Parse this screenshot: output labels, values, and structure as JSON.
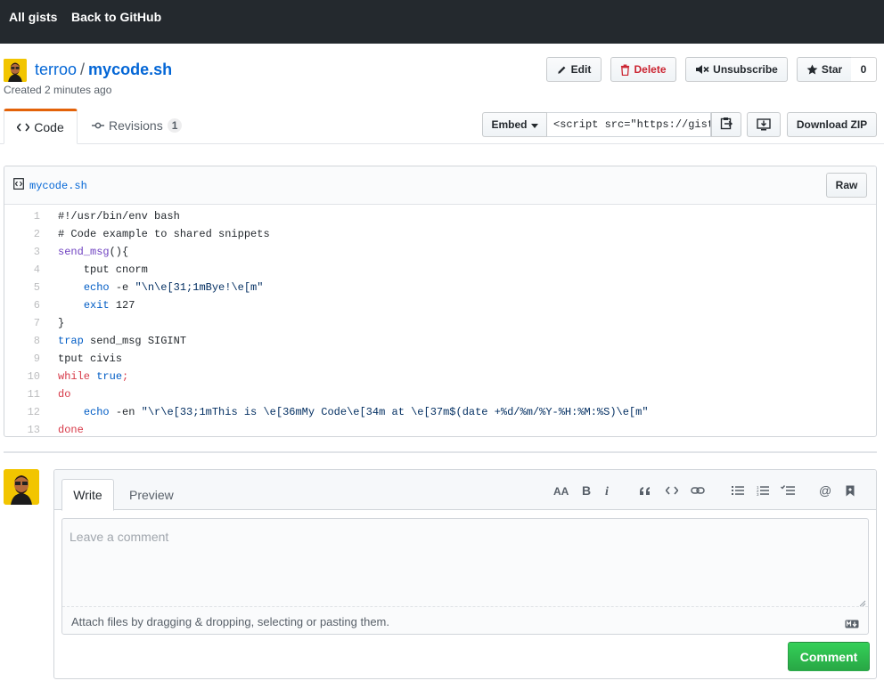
{
  "topbar": {
    "all_gists": "All gists",
    "back_to_github": "Back to GitHub"
  },
  "gist": {
    "owner": "terroo",
    "separator": "/",
    "filename": "mycode.sh",
    "created": "Created 2 minutes ago"
  },
  "actions": {
    "edit": "Edit",
    "delete": "Delete",
    "unsubscribe": "Unsubscribe",
    "star": "Star",
    "star_count": "0"
  },
  "tabs": {
    "code": "Code",
    "revisions": "Revisions",
    "revisions_count": "1"
  },
  "embed": {
    "label": "Embed",
    "value": "<script src=\"https://gist.",
    "download": "Download ZIP"
  },
  "file": {
    "name": "mycode.sh",
    "raw": "Raw",
    "lines": [
      {
        "n": "1",
        "t": "#!/usr/bin/env bash"
      },
      {
        "n": "2",
        "t": "# Code example to shared snippets"
      },
      {
        "n": "3",
        "t": "send_msg(){"
      },
      {
        "n": "4",
        "t": "    tput cnorm"
      },
      {
        "n": "5",
        "t": "    echo -e \"\\n\\e[31;1mBye!\\e[m\""
      },
      {
        "n": "6",
        "t": "    exit 127"
      },
      {
        "n": "7",
        "t": "}"
      },
      {
        "n": "8",
        "t": "trap send_msg SIGINT"
      },
      {
        "n": "9",
        "t": "tput civis"
      },
      {
        "n": "10",
        "t": "while true;"
      },
      {
        "n": "11",
        "t": "do"
      },
      {
        "n": "12",
        "t": "    echo -en \"\\r\\e[33;1mThis is \\e[36mMy Code\\e[34m at \\e[37m$(date +%d/%m/%Y-%H:%M:%S)\\e[m\""
      },
      {
        "n": "13",
        "t": "done"
      }
    ]
  },
  "comment": {
    "write": "Write",
    "preview": "Preview",
    "placeholder": "Leave a comment",
    "attach": "Attach files by dragging & dropping, selecting or pasting them.",
    "submit": "Comment"
  },
  "colors": {
    "topbar": "#24292e",
    "link": "#0366d6",
    "delete": "#cb2431",
    "tab_accent": "#e36209",
    "submit": "#2ea44f"
  }
}
